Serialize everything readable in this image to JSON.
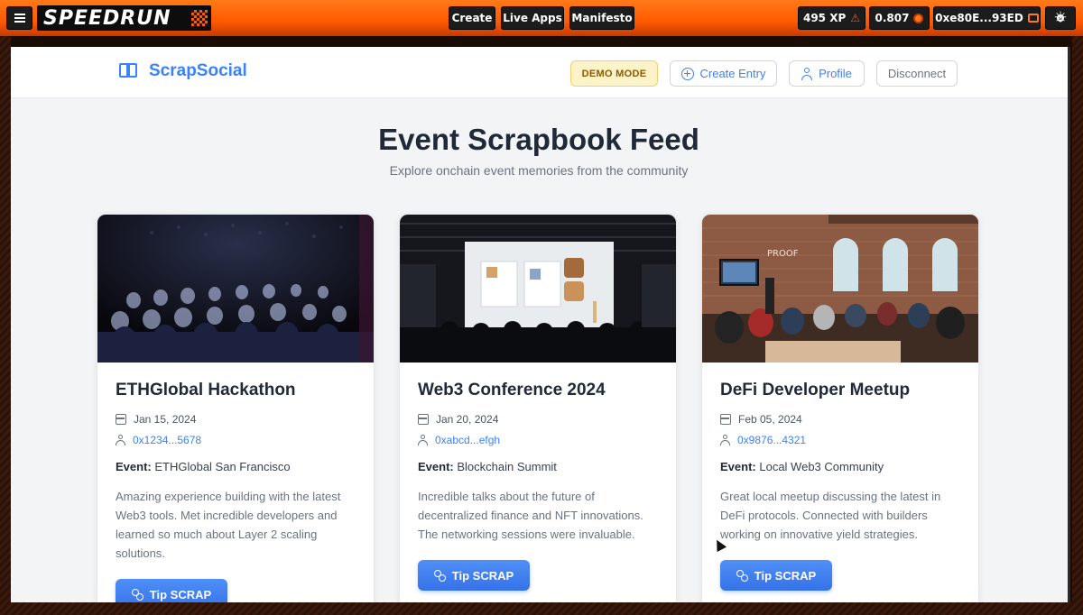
{
  "topbar": {
    "logo_text": "SPEEDRUN",
    "nav": {
      "create": "Create",
      "live_apps": "Live Apps",
      "manifesto": "Manifesto"
    },
    "xp": "495 XP",
    "balance": "0.807",
    "address": "0xe80E...93ED",
    "icons": {
      "menu": "hamburger-menu-icon",
      "xp": "triangle-icon",
      "balance": "coin-icon",
      "address": "wallet-icon",
      "theme": "sun-icon"
    },
    "accent_color": "#ff5a00"
  },
  "app": {
    "brand": "ScrapSocial",
    "demo_mode": "DEMO MODE",
    "create_entry": "Create Entry",
    "profile": "Profile",
    "disconnect": "Disconnect",
    "accent_color": "#3b82f6"
  },
  "feed": {
    "title": "Event Scrapbook Feed",
    "subtitle": "Explore onchain event memories from the community",
    "event_label": "Event:",
    "cards": [
      {
        "title": "ETHGlobal Hackathon",
        "date": "Jan 15, 2024",
        "author": "0x1234...5678",
        "event": "ETHGlobal San Francisco",
        "description": "Amazing experience building with the latest Web3 tools. Met incredible developers and learned so much about Layer 2 scaling solutions.",
        "tip_label": "Tip SCRAP"
      },
      {
        "title": "Web3 Conference 2024",
        "date": "Jan 20, 2024",
        "author": "0xabcd...efgh",
        "event": "Blockchain Summit",
        "description": "Incredible talks about the future of decentralized finance and NFT innovations. The networking sessions were invaluable.",
        "tip_label": "Tip SCRAP"
      },
      {
        "title": "DeFi Developer Meetup",
        "date": "Feb 05, 2024",
        "author": "0x9876...4321",
        "event": "Local Web3 Community",
        "description": "Great local meetup discussing the latest in DeFi protocols. Connected with builders working on innovative yield strategies.",
        "tip_label": "Tip SCRAP",
        "photo_sign": "PROOF"
      }
    ]
  }
}
